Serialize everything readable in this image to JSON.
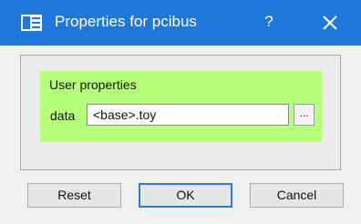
{
  "window": {
    "title": "Properties for pcibus",
    "help_label": "?",
    "icons": {
      "app": "window-icon",
      "close": "close-icon"
    },
    "colors": {
      "titlebar": "#1f78d9",
      "group_background": "#b6ff7a",
      "default_button_border": "#2c7be5"
    }
  },
  "group": {
    "label": "User properties",
    "field": {
      "label": "data",
      "value": "<base>.toy",
      "browse_label": "..."
    }
  },
  "buttons": {
    "reset": "Reset",
    "ok": "OK",
    "cancel": "Cancel"
  }
}
